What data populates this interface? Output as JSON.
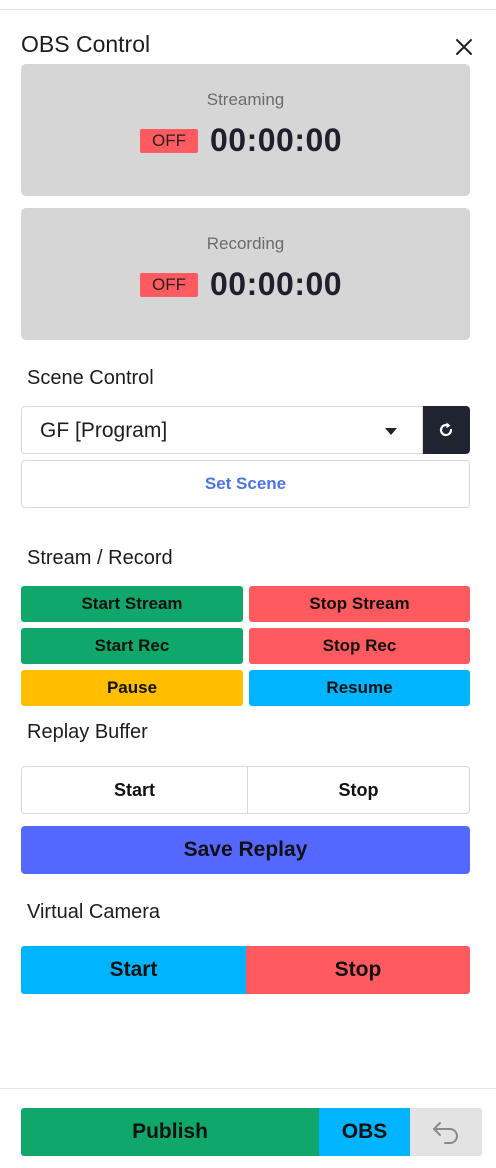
{
  "panel": {
    "title": "OBS Control"
  },
  "status": {
    "streaming": {
      "label": "Streaming",
      "state": "OFF",
      "time": "00:00:00"
    },
    "recording": {
      "label": "Recording",
      "state": "OFF",
      "time": "00:00:00"
    }
  },
  "scene_control": {
    "heading": "Scene Control",
    "selected_scene": "GF [Program]",
    "set_scene_label": "Set Scene"
  },
  "stream_record": {
    "heading": "Stream / Record",
    "start_stream": "Start Stream",
    "stop_stream": "Stop Stream",
    "start_rec": "Start Rec",
    "stop_rec": "Stop Rec",
    "pause": "Pause",
    "resume": "Resume"
  },
  "replay_buffer": {
    "heading": "Replay Buffer",
    "start": "Start",
    "stop": "Stop",
    "save": "Save Replay"
  },
  "virtual_camera": {
    "heading": "Virtual Camera",
    "start": "Start",
    "stop": "Stop"
  },
  "footer": {
    "publish": "Publish",
    "obs": "OBS"
  },
  "icons": {
    "close": "close-icon",
    "refresh": "refresh-icon",
    "dropdown": "chevron-down-icon",
    "back": "undo-icon"
  },
  "colors": {
    "start": "#0fa86a",
    "stop": "#ff5a5f",
    "pause": "#ffbf00",
    "resume": "#00b4ff",
    "save_replay": "#5468ff",
    "off_badge": "#ff5a5f",
    "status_card": "#d6d6d6",
    "accent_text": "#4f73e6"
  }
}
